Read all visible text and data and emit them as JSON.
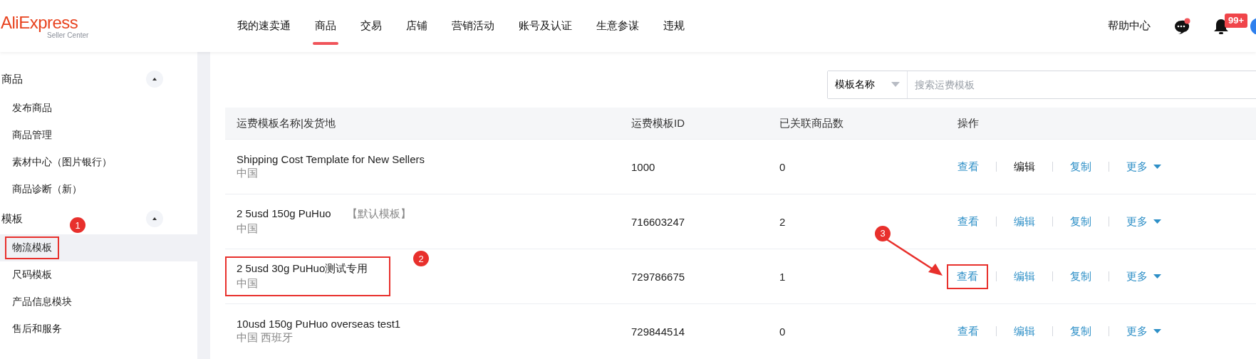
{
  "header": {
    "logo": "AliExpress",
    "logo_sub": "Seller Center",
    "nav": [
      {
        "label": "我的速卖通",
        "selected": false
      },
      {
        "label": "商品",
        "selected": true
      },
      {
        "label": "交易",
        "selected": false
      },
      {
        "label": "店铺",
        "selected": false
      },
      {
        "label": "营销活动",
        "selected": false
      },
      {
        "label": "账号及认证",
        "selected": false
      },
      {
        "label": "生意参谋",
        "selected": false
      },
      {
        "label": "违规",
        "selected": false
      }
    ],
    "help": "帮助中心",
    "notifications_badge": "99+"
  },
  "sidebar": {
    "groups": [
      {
        "title": "商品",
        "expanded": true,
        "items": [
          {
            "label": "发布商品",
            "selected": false
          },
          {
            "label": "商品管理",
            "selected": false
          },
          {
            "label": "素材中心（图片银行）",
            "selected": false
          },
          {
            "label": "商品诊断（新）",
            "selected": false
          }
        ]
      },
      {
        "title": "模板",
        "expanded": true,
        "items": [
          {
            "label": "物流模板",
            "selected": true,
            "callout": "1"
          },
          {
            "label": "尺码模板",
            "selected": false
          },
          {
            "label": "产品信息模块",
            "selected": false
          },
          {
            "label": "售后和服务",
            "selected": false
          }
        ]
      }
    ]
  },
  "search": {
    "scope": "模板名称",
    "placeholder": "搜索运费模板"
  },
  "table": {
    "columns": [
      "运费模板名称|发货地",
      "运费模板ID",
      "已关联商品数",
      "操作"
    ],
    "rows": [
      {
        "name": "Shipping Cost Template for New Sellers",
        "origin": "中国",
        "id": "1000",
        "count": "0",
        "actions": [
          {
            "label": "查看",
            "dark": false
          },
          {
            "label": "编辑",
            "dark": true
          },
          {
            "label": "复制",
            "dark": false
          }
        ],
        "more": "更多"
      },
      {
        "name": "2 5usd 150g PuHuo",
        "tag": "【默认模板】",
        "origin": "中国",
        "id": "716603247",
        "count": "2",
        "actions": [
          {
            "label": "查看",
            "dark": false
          },
          {
            "label": "编辑",
            "dark": false
          },
          {
            "label": "复制",
            "dark": false
          }
        ],
        "more": "更多"
      },
      {
        "name": "2 5usd 30g PuHuo测试专用",
        "origin": "中国",
        "id": "729786675",
        "count": "1",
        "name_callout": "2",
        "actions": [
          {
            "label": "查看",
            "dark": false,
            "callout": "3"
          },
          {
            "label": "编辑",
            "dark": false
          },
          {
            "label": "复制",
            "dark": false
          }
        ],
        "more": "更多"
      },
      {
        "name": "10usd 150g PuHuo overseas test1",
        "origin": "中国 西班牙",
        "id": "729844514",
        "count": "0",
        "actions": [
          {
            "label": "查看",
            "dark": false
          },
          {
            "label": "编辑",
            "dark": false
          },
          {
            "label": "复制",
            "dark": false
          }
        ],
        "more": "更多"
      }
    ]
  }
}
